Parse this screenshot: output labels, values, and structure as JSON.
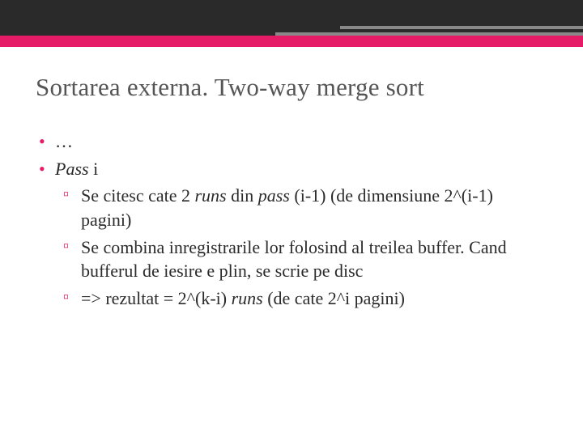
{
  "title": "Sortarea externa. Two-way merge sort",
  "bullets": {
    "b0": "…",
    "b1_prefix": "Pass",
    "b1_suffix": " i"
  },
  "sub": {
    "s0_a": "Se citesc cate 2 ",
    "s0_b": "runs",
    "s0_c": " din ",
    "s0_d": "pass",
    "s0_e": " (i-1) (de dimensiune 2^(i-1) pagini)",
    "s1": "Se combina inregistrarile lor folosind al treilea buffer. Cand bufferul de iesire e plin, se scrie pe disc",
    "s2_a": "=> rezultat = 2^(k-i) ",
    "s2_b": "runs",
    "s2_c": " (de cate 2^i pagini)"
  }
}
